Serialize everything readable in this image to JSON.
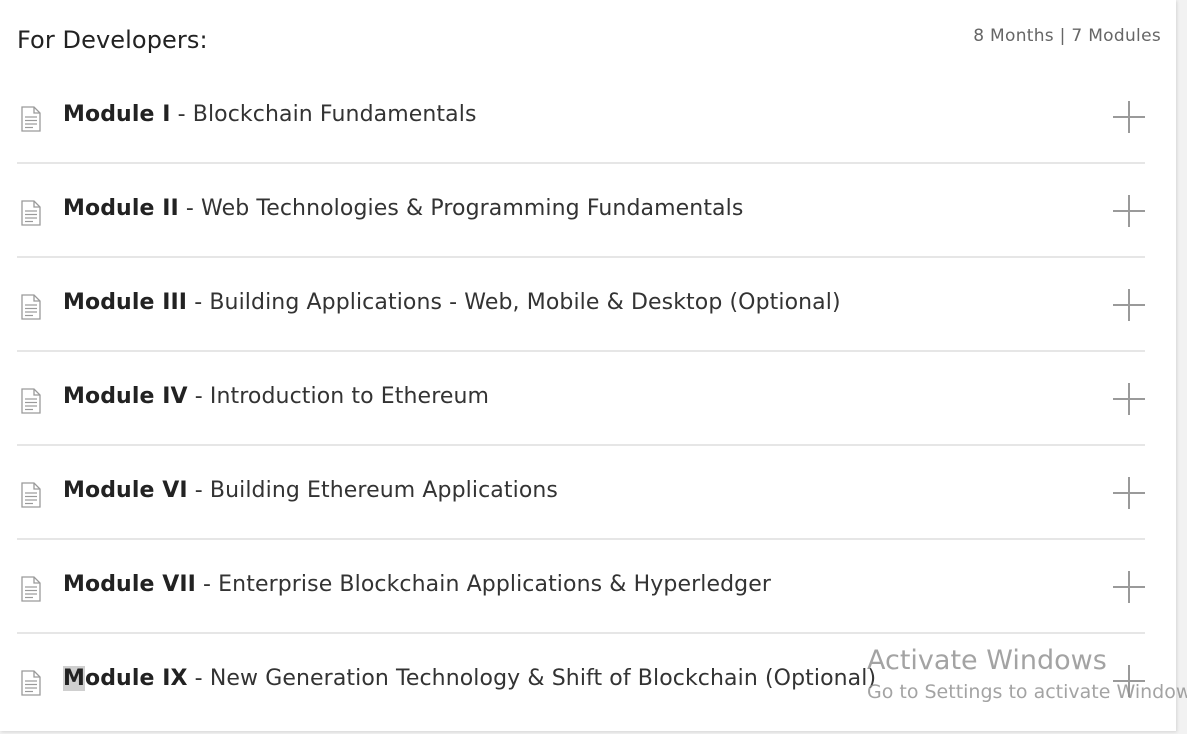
{
  "header": {
    "title": "For Developers:",
    "meta": "8 Months | 7 Modules"
  },
  "modules": [
    {
      "name": "Module I",
      "separator": " - ",
      "title": "Blockchain Fundamentals"
    },
    {
      "name": "Module II",
      "separator": " - ",
      "title": "Web Technologies & Programming Fundamentals"
    },
    {
      "name": "Module III",
      "separator": " - ",
      "title": "Building Applications - Web, Mobile & Desktop (Optional)"
    },
    {
      "name": "Module IV",
      "separator": " - ",
      "title": "Introduction to Ethereum"
    },
    {
      "name": "Module VI",
      "separator": " - ",
      "title": "Building Ethereum Applications"
    },
    {
      "name": "Module VII",
      "separator": " - ",
      "title": "Enterprise Blockchain Applications & Hyperledger"
    },
    {
      "name_first_letter": "M",
      "name_rest": "odule IX",
      "separator": " - ",
      "title": "New Generation Technology & Shift of Blockchain (Optional)"
    }
  ],
  "icons": {
    "row_icon": "document-icon",
    "expand_icon": "plus-icon"
  },
  "watermark": {
    "title": "Activate Windows",
    "subtitle": "Go to Settings to activate Windows."
  },
  "colors": {
    "divider": "#e6e6e6",
    "icon": "#9a9a9a",
    "plus": "#9a9a9a"
  }
}
